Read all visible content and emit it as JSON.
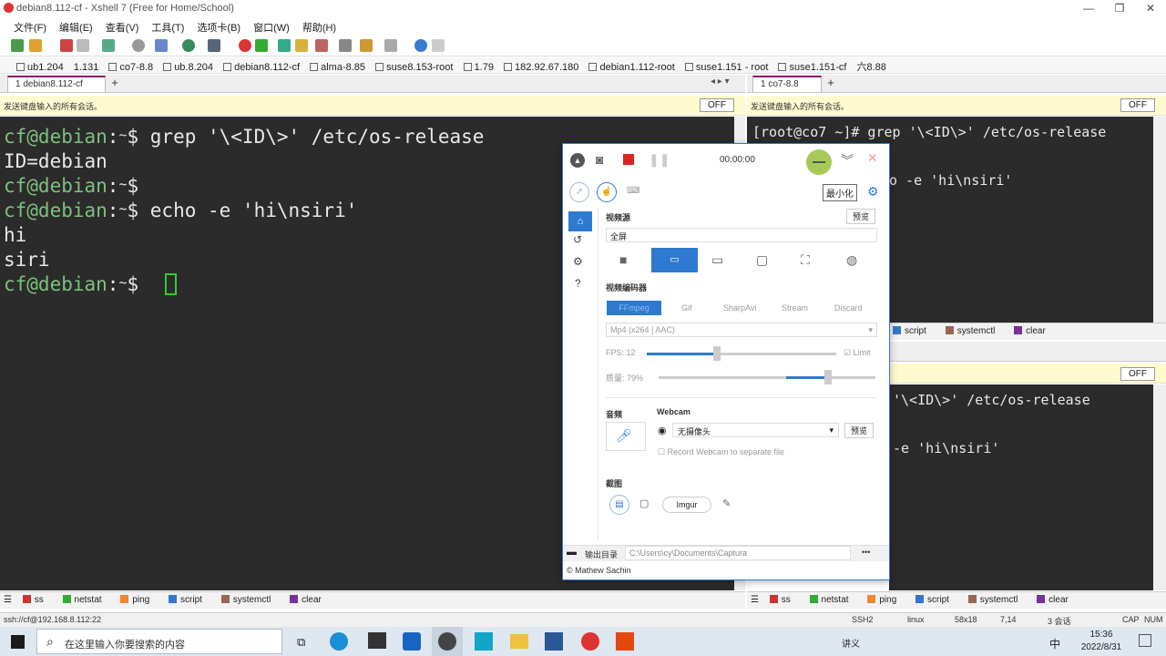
{
  "window": {
    "title": "debian8.112-cf - Xshell 7 (Free for Home/School)"
  },
  "menu": [
    "文件(F)",
    "编辑(E)",
    "查看(V)",
    "工具(T)",
    "选项卡(B)",
    "窗口(W)",
    "帮助(H)"
  ],
  "sessions": [
    "ub1.204",
    "1.131",
    "co7-8.8",
    "ub.8.204",
    "debian8.112-cf",
    "alma-8.85",
    "suse8.153-root",
    "1.79",
    "182.92.67.180",
    "debian1.112-root",
    "suse1.151 - root",
    "suse1.151-cf",
    "六8.88"
  ],
  "left": {
    "tab": "1 debian8.112-cf",
    "notice": "发送键盘输入的所有会话。",
    "off": "OFF",
    "lines": [
      {
        "user": "cf@debian",
        "sep": ":",
        "tilde": "~",
        "prompt": "$",
        "cmd": " grep '\\<ID\\>' /etc/os-release"
      },
      {
        "plain": "ID=debian"
      },
      {
        "user": "cf@debian",
        "sep": ":",
        "tilde": "~",
        "prompt": "$",
        "cmd": ""
      },
      {
        "user": "cf@debian",
        "sep": ":",
        "tilde": "~",
        "prompt": "$",
        "cmd": " echo -e 'hi\\nsiri'"
      },
      {
        "plain": "hi"
      },
      {
        "plain": "siri"
      },
      {
        "user": "cf@debian",
        "sep": ":",
        "tilde": "~",
        "prompt": "$",
        "cmd": " "
      }
    ],
    "quick": [
      "ss",
      "netstat",
      "ping",
      "script",
      "systemctl",
      "clear"
    ]
  },
  "right_top": {
    "tab": "1 co7-8.8",
    "notice": "发送键盘输入的所有会话。",
    "off": "OFF",
    "line1": "[root@co7 ~]# grep '\\<ID\\>' /etc/os-release",
    "line2": "o -e 'hi\\nsiri'",
    "quick": [
      "script",
      "systemctl",
      "clear"
    ]
  },
  "right_bottom": {
    "off": "OFF",
    "line1": "'\\<ID\\>' /etc/os-release",
    "line2": "-e 'hi\\nsiri'",
    "quick": [
      "ss",
      "netstat",
      "ping",
      "script",
      "systemctl",
      "clear"
    ]
  },
  "status": {
    "conn": "ssh://cf@192.168.8.112:22",
    "proto": "SSH2",
    "term": "linux",
    "size": "58x18",
    "pos": "7,14",
    "sessions": "3 会话",
    "cap": "CAP",
    "num": "NUM"
  },
  "captura": {
    "timer": "00:00:00",
    "tooltip": "最小化",
    "video_source_label": "视频源",
    "preview": "预览",
    "source_value": "全屏",
    "encoder_label": "视频编码器",
    "encoder_tabs": [
      "FFmpeg",
      "Gif",
      "SharpAvi",
      "Stream",
      "Discard"
    ],
    "codec": "Mp4 (x264 | AAC)",
    "fps_label": "FPS:",
    "fps": "12",
    "limit": "Limit",
    "quality_label": "质量:",
    "quality": "79%",
    "audio_label": "音频",
    "webcam_label": "Webcam",
    "webcam_value": "无摄像头",
    "webcam_preview": "预览",
    "record_webcam": "Record Webcam to separate file",
    "screenshot_label": "截图",
    "imgur": "Imgur",
    "output_label": "输出目录",
    "output_path": "C:\\Users\\cy\\Documents\\Captura",
    "more": "•••",
    "credit": "© Mathew Sachin"
  },
  "taskbar": {
    "search": "在这里输入你要搜索的内容",
    "ime": "讲义",
    "lang": "中",
    "time": "15:36",
    "date": "2022/8/31"
  },
  "colors": {
    "terminal_bg": "#2b2b2b",
    "prompt_green": "#7ec07e",
    "accent": "#2e7ad1",
    "tab_accent": "#8d1a6a"
  }
}
